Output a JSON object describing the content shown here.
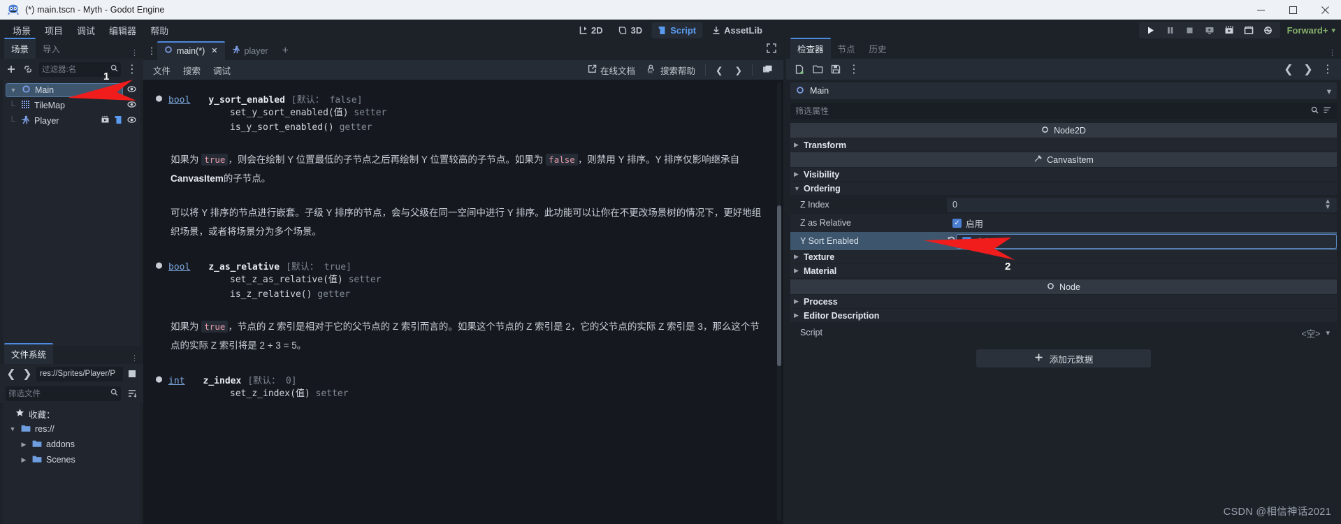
{
  "window": {
    "title": "(*) main.tscn - Myth - Godot Engine",
    "icon": "godot-robot-icon",
    "controls": {
      "minimize": "─",
      "maximize": "☐",
      "close": "✕"
    }
  },
  "menubar": {
    "items": [
      "场景",
      "项目",
      "调试",
      "编辑器",
      "帮助"
    ],
    "modes": [
      {
        "label": "2D",
        "icon": "2d-icon",
        "active": false
      },
      {
        "label": "3D",
        "icon": "3d-icon",
        "active": false
      },
      {
        "label": "Script",
        "icon": "script-icon",
        "active": true
      },
      {
        "label": "AssetLib",
        "icon": "assetlib-icon",
        "active": false
      }
    ],
    "play_controls": [
      {
        "name": "play-button",
        "icon": "play-icon"
      },
      {
        "name": "pause-button",
        "icon": "pause-icon"
      },
      {
        "name": "stop-button",
        "icon": "stop-icon"
      },
      {
        "name": "run-current-scene-button",
        "icon": "monitor-play-icon"
      },
      {
        "name": "play-movie-button",
        "icon": "movie-play-icon"
      },
      {
        "name": "play-custom-scene-button",
        "icon": "movie-custom-icon"
      },
      {
        "name": "remote-debug-button",
        "icon": "network-debug-icon"
      }
    ],
    "renderer": {
      "label": "Forward+",
      "caret": "∨"
    }
  },
  "scene_dock": {
    "tabs": [
      {
        "label": "场景",
        "active": true
      },
      {
        "label": "导入",
        "active": false
      }
    ],
    "toolbar": {
      "add_node": "+",
      "instance_child": "link-icon",
      "filter_placeholder": "过滤器:名",
      "search_icon": "search-icon",
      "kebab": "kebab-icon"
    },
    "tree": [
      {
        "name": "Main",
        "icon": "node2d-icon",
        "depth": 0,
        "selected": true,
        "expanded": true,
        "visibility": true,
        "extra_icons": []
      },
      {
        "name": "TileMap",
        "icon": "tilemap-icon",
        "depth": 1,
        "selected": false,
        "visibility": true,
        "extra_icons": []
      },
      {
        "name": "Player",
        "icon": "player-icon",
        "depth": 1,
        "selected": false,
        "visibility": true,
        "extra_icons": [
          "animation-icon",
          "script-icon"
        ]
      }
    ]
  },
  "filesystem_dock": {
    "tabs": [
      {
        "label": "文件系统",
        "active": true
      }
    ],
    "nav": {
      "back": "❮",
      "forward": "❯",
      "path": "res://Sprites/Player/P",
      "toggle_split": "split-icon"
    },
    "filter": {
      "placeholder": "筛选文件",
      "search_icon": "search-icon",
      "sort_icon": "sort-icon"
    },
    "tree": [
      {
        "label": "收藏：",
        "icon": "star-icon",
        "depth": 0
      },
      {
        "label": "res://",
        "icon": "folder-icon",
        "depth": 0,
        "expanded": true
      },
      {
        "label": "addons",
        "icon": "folder-icon",
        "depth": 1
      },
      {
        "label": "Scenes",
        "icon": "folder-icon",
        "depth": 1
      }
    ]
  },
  "script_editor": {
    "tabs": [
      {
        "label": "main(*)",
        "icon": "node2d-icon",
        "active": true,
        "closable": true
      },
      {
        "label": "player",
        "icon": "player-icon",
        "active": false,
        "closable": false
      }
    ],
    "new_tab": "+",
    "expand_icon": "fullscreen-icon",
    "toolbar": {
      "menus": [
        "文件",
        "搜索",
        "调试"
      ],
      "online_docs": {
        "label": "在线文档",
        "icon": "external-link-icon"
      },
      "search_help": {
        "label": "搜索帮助",
        "icon": "doc-search-icon"
      },
      "nav_back": "❮",
      "nav_forward": "❯",
      "windows": "panels-icon"
    }
  },
  "doc_content": {
    "members": [
      {
        "type": "bool",
        "name": "y_sort_enabled",
        "default_prefix": "[默认：",
        "default_value": "false",
        "default_suffix": "]",
        "setter": "set_y_sort_enabled(值)",
        "setter_kw": "setter",
        "getter": "is_y_sort_enabled()",
        "getter_kw": "getter"
      },
      {
        "type": "bool",
        "name": "z_as_relative",
        "default_prefix": "[默认：",
        "default_value": "true",
        "default_suffix": "]",
        "setter": "set_z_as_relative(值)",
        "setter_kw": "setter",
        "getter": "is_z_relative()",
        "getter_kw": "getter"
      },
      {
        "type": "int",
        "name": "z_index",
        "default_prefix": "[默认：",
        "default_value": "0",
        "default_suffix": "]",
        "setter": "set_z_index(值)",
        "setter_kw": "setter",
        "getter": "",
        "getter_kw": ""
      }
    ],
    "paragraph1_a": "如果为",
    "paragraph1_code1": "true",
    "paragraph1_b": "，则会在绘制 Y 位置最低的子节点之后再绘制 Y 位置较高的子节点。如果为",
    "paragraph1_code2": "false",
    "paragraph1_c": "，则禁用 Y 排序。Y 排序仅影响继承自",
    "paragraph1_bold": "CanvasItem",
    "paragraph1_d": "的子节点。",
    "paragraph2": "可以将 Y 排序的节点进行嵌套。子级 Y 排序的节点，会与父级在同一空间中进行 Y 排序。此功能可以让你在不更改场景树的情况下，更好地组织场景，或者将场景分为多个场景。",
    "paragraph3_a": "如果为",
    "paragraph3_code": "true",
    "paragraph3_b": "，节点的 Z 索引是相对于它的父节点的 Z 索引而言的。如果这个节点的 Z 索引是 2，它的父节点的实际 Z 索引是 3，那么这个节点的实际 Z 索引将是 2 + 3 = 5。"
  },
  "inspector": {
    "tabs": [
      {
        "label": "检查器",
        "active": true
      },
      {
        "label": "节点",
        "active": false
      },
      {
        "label": "历史",
        "active": false
      }
    ],
    "toolbar": {
      "new_resource": "new-resource-icon",
      "load": "folder-open-icon",
      "save": "save-icon",
      "tools": "kebab-icon",
      "nav_back": "❮",
      "nav_forward": "❯",
      "history": "history-icon"
    },
    "node_selector": {
      "label": "Main",
      "icon": "node2d-icon",
      "caret": "⌄",
      "open_docs": "open-docs-icon"
    },
    "property_filter": {
      "placeholder": "筛选属性",
      "search_icon": "search-icon",
      "sort_icon": "sort-icon"
    },
    "sections": [
      {
        "kind": "category",
        "label": "Node2D",
        "icon": "node2d-icon"
      },
      {
        "kind": "group",
        "label": "Transform",
        "expanded": false
      },
      {
        "kind": "category",
        "label": "CanvasItem",
        "icon": "canvasitem-icon"
      },
      {
        "kind": "group",
        "label": "Visibility",
        "expanded": false
      },
      {
        "kind": "group",
        "label": "Ordering",
        "expanded": true
      },
      {
        "kind": "property",
        "label": "Z Index",
        "value": "0",
        "control": "spinbox",
        "highlight": false
      },
      {
        "kind": "property",
        "label": "Z as Relative",
        "value": "启用",
        "control": "checkbox",
        "checked": true,
        "highlight": false
      },
      {
        "kind": "property",
        "label": "Y Sort Enabled",
        "value": "启用",
        "control": "checkbox",
        "checked": true,
        "highlight": true,
        "revert": "revert-icon"
      },
      {
        "kind": "group",
        "label": "Texture",
        "expanded": false
      },
      {
        "kind": "group",
        "label": "Material",
        "expanded": false
      },
      {
        "kind": "category",
        "label": "Node",
        "icon": "node-icon"
      },
      {
        "kind": "group",
        "label": "Process",
        "expanded": false
      },
      {
        "kind": "group",
        "label": "Editor Description",
        "expanded": false
      }
    ],
    "script_property": {
      "label": "Script",
      "value": "<空>",
      "caret": "⌄"
    },
    "add_metadata": {
      "label": "添加元数据",
      "icon": "plus-icon"
    }
  },
  "annotations": [
    {
      "number": "1",
      "color": "#f11c1c"
    },
    {
      "number": "2",
      "color": "#f11c1c"
    }
  ],
  "watermark": "CSDN @相信神话2021"
}
